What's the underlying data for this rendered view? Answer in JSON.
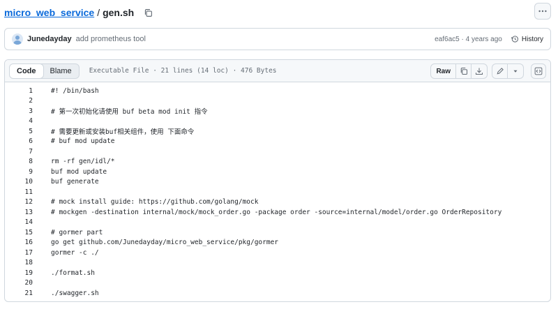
{
  "breadcrumb": {
    "repo": "micro_web_service",
    "separator": "/",
    "file": "gen.sh"
  },
  "commit": {
    "author": "Junedayday",
    "message": "add prometheus tool",
    "hash": "eaf6ac5",
    "age": "4 years ago",
    "history_label": "History"
  },
  "file": {
    "tabs": [
      "Code",
      "Blame"
    ],
    "info": "Executable File · 21 lines (14 loc) · 476 Bytes",
    "raw_label": "Raw"
  },
  "icons": {
    "copy_path": "copy-icon",
    "more": "kebab-horizontal-icon",
    "history": "history-icon",
    "copy_raw": "copy-icon",
    "download": "download-icon",
    "edit": "pencil-icon",
    "edit_menu": "triangle-down-icon",
    "symbols": "code-square-icon"
  },
  "code_lines": [
    {
      "n": "1",
      "t": "#! /bin/bash"
    },
    {
      "n": "2",
      "t": ""
    },
    {
      "n": "3",
      "t": "# 第一次初始化请使用 buf beta mod init 指令"
    },
    {
      "n": "4",
      "t": ""
    },
    {
      "n": "5",
      "t": "# 需要更新或安装buf相关组件，使用 下面命令"
    },
    {
      "n": "6",
      "t": "# buf mod update"
    },
    {
      "n": "7",
      "t": ""
    },
    {
      "n": "8",
      "t": "rm -rf gen/idl/*"
    },
    {
      "n": "9",
      "t": "buf mod update"
    },
    {
      "n": "10",
      "t": "buf generate"
    },
    {
      "n": "11",
      "t": ""
    },
    {
      "n": "12",
      "t": "# mock install guide: https://github.com/golang/mock"
    },
    {
      "n": "13",
      "t": "# mockgen -destination internal/mock/mock_order.go -package order -source=internal/model/order.go OrderRepository"
    },
    {
      "n": "14",
      "t": ""
    },
    {
      "n": "15",
      "t": "# gormer part"
    },
    {
      "n": "16",
      "t": "go get github.com/Junedayday/micro_web_service/pkg/gormer"
    },
    {
      "n": "17",
      "t": "gormer -c ./"
    },
    {
      "n": "18",
      "t": ""
    },
    {
      "n": "19",
      "t": "./format.sh"
    },
    {
      "n": "20",
      "t": ""
    },
    {
      "n": "21",
      "t": "./swagger.sh"
    }
  ]
}
